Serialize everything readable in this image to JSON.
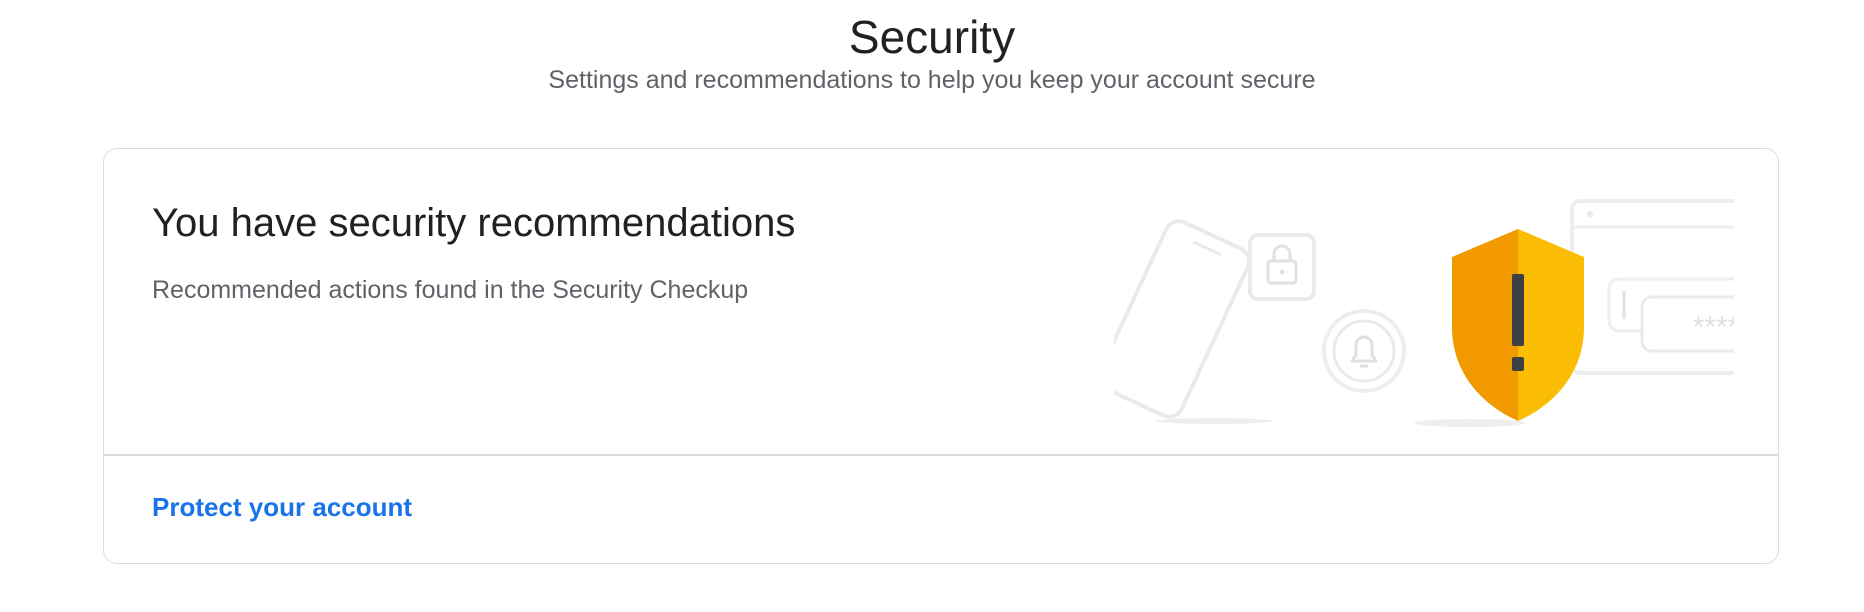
{
  "header": {
    "title": "Security",
    "subtitle": "Settings and recommendations to help you keep your account secure"
  },
  "card": {
    "title": "You have security recommendations",
    "description": "Recommended actions found in the Security Checkup",
    "footer_link": "Protect your account",
    "illustration": {
      "icons": [
        "phone-icon",
        "lock-icon",
        "bell-icon",
        "warning-shield-icon",
        "browser-window-icon",
        "password-field-icon"
      ],
      "password_mask": "****",
      "shield_symbol": "!",
      "colors": {
        "shield_left": "#f29900",
        "shield_right": "#fbbc04",
        "shield_mark": "#3c4043",
        "outline_gray": "#e8eaed"
      }
    }
  },
  "colors": {
    "link": "#1a73e8",
    "title_text": "#202124",
    "secondary_text": "#5f6368",
    "border": "#dadce0"
  }
}
